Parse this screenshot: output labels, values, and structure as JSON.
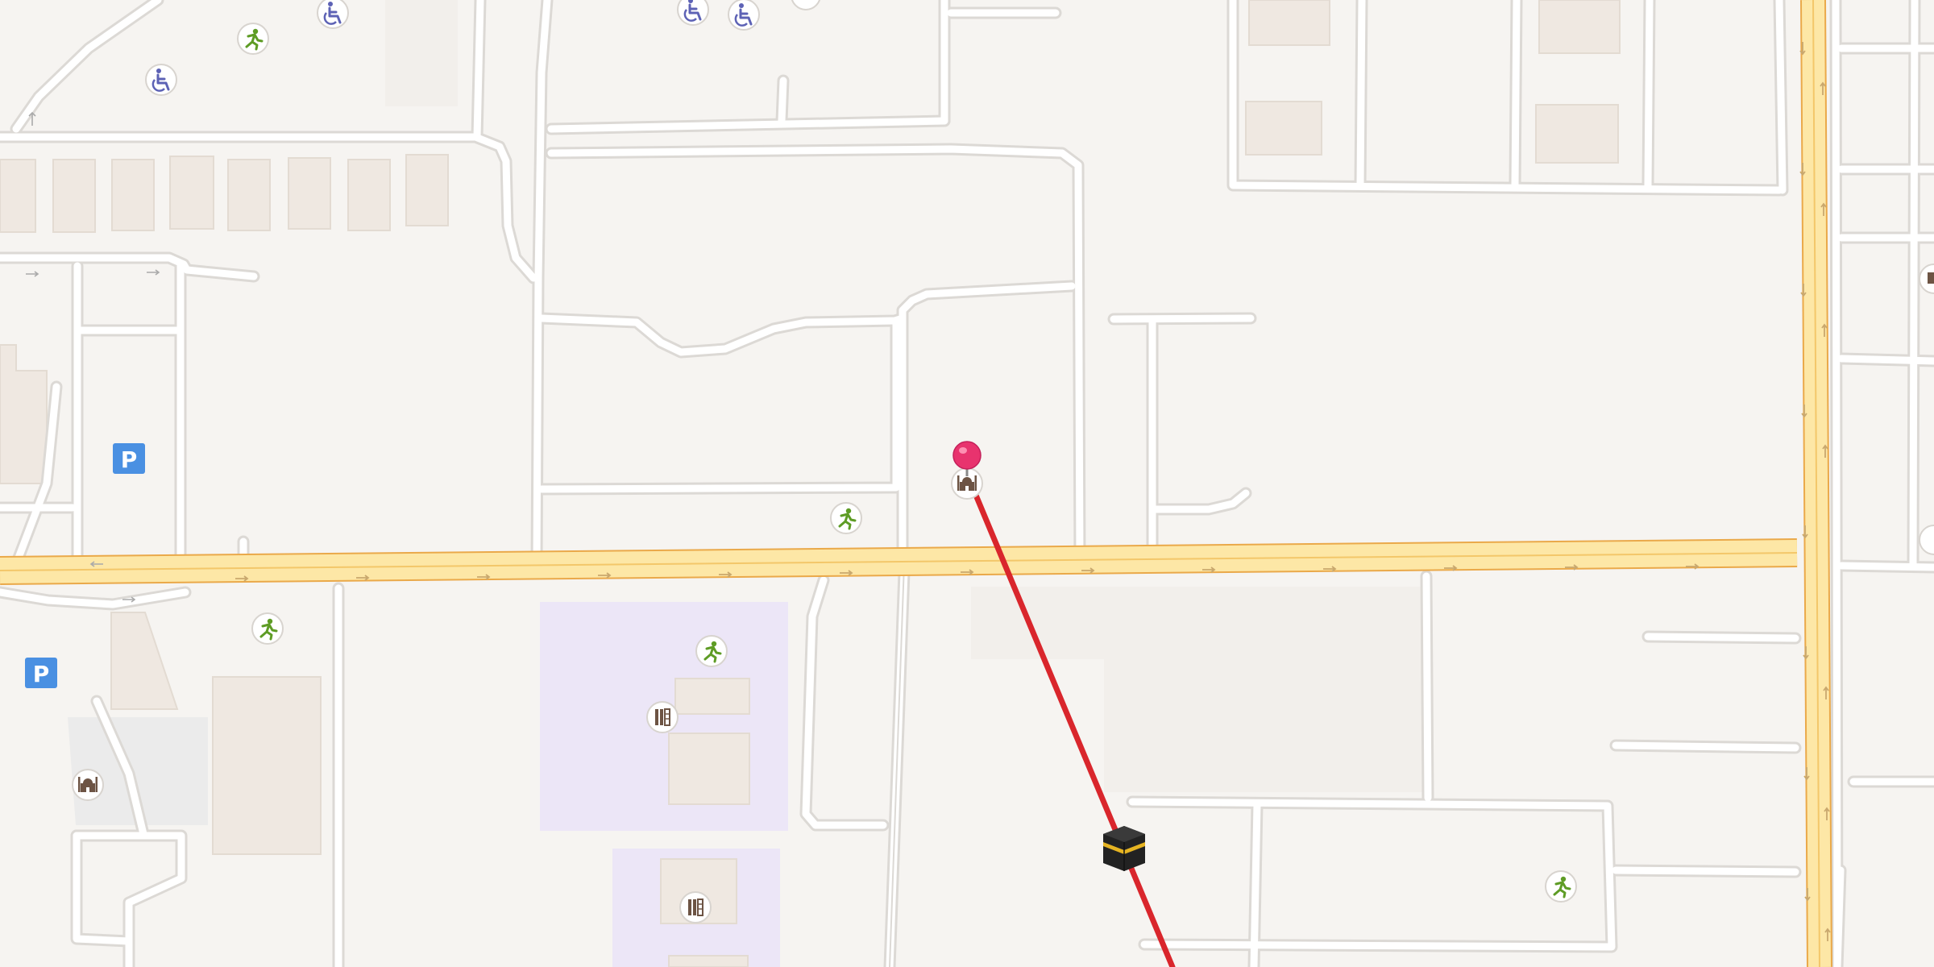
{
  "map": {
    "colors": {
      "background": "#f6f4f1",
      "road_fill": "#ffffff",
      "road_casing": "#dcd9d5",
      "arterial_fill": "#fde7a6",
      "arterial_casing": "#eaa94a",
      "arrow": "#c9a86e",
      "minor_arrow": "#aaaaaa",
      "building": "#efe8e1",
      "building_edge": "#e3dbd2",
      "paved_area": "#ebebeb",
      "landuse_purple": "#ece6f7",
      "route_line": "#d9262c",
      "pin": "#e8336e",
      "parking_badge": "#4a90e2",
      "poi_green": "#5e9c25",
      "poi_blue": "#5d62b5",
      "poi_brown": "#6d5444"
    },
    "parking_label": "P",
    "markers": [
      {
        "name": "destination-pin",
        "icon": "pin-icon"
      },
      {
        "name": "kaaba-marker",
        "icon": "kaaba-icon"
      }
    ],
    "poi_icons": [
      "running-person-icon",
      "accessibility-icon",
      "mosque-icon",
      "library-icon",
      "parking-icon"
    ]
  }
}
